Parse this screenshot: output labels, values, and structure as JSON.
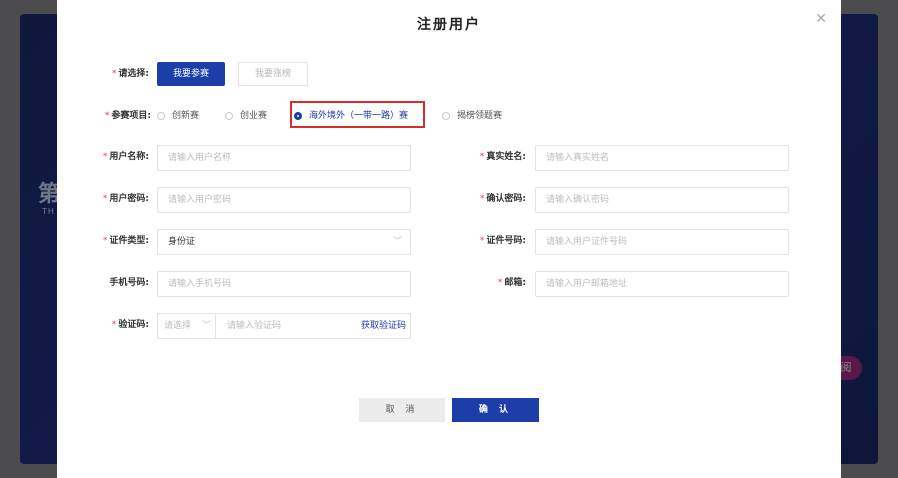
{
  "background": {
    "left_heading": "第",
    "left_sub": "TH",
    "right_button": "阅"
  },
  "modal": {
    "title": "注册用户",
    "close_icon": "close-icon"
  },
  "choose": {
    "label": "请选择:",
    "options": [
      "我要参赛",
      "我要涨榜"
    ],
    "selected": "我要参赛"
  },
  "project": {
    "label": "参赛项目:",
    "options": [
      "创新赛",
      "创业赛",
      "海外境外（一带一路）赛",
      "揭榜领题赛"
    ],
    "selected": "海外境外（一带一路）赛"
  },
  "fields": {
    "username": {
      "label": "用户名称:",
      "placeholder": "请输入用户名称",
      "required": true
    },
    "realname": {
      "label": "真实姓名:",
      "placeholder": "请输入真实姓名",
      "required": true
    },
    "password": {
      "label": "用户密码:",
      "placeholder": "请输入用户密码",
      "required": true
    },
    "confirm_password": {
      "label": "确认密码:",
      "placeholder": "请输入确认密码",
      "required": true
    },
    "id_type": {
      "label": "证件类型:",
      "value": "身份证",
      "required": true
    },
    "id_number": {
      "label": "证件号码:",
      "placeholder": "请输入用户证件号码",
      "required": true
    },
    "phone": {
      "label": "手机号码:",
      "placeholder": "请输入手机号码",
      "required": false
    },
    "email": {
      "label": "邮箱:",
      "placeholder": "请输入用户邮箱地址",
      "required": true
    },
    "captcha": {
      "label": "验证码:",
      "select_placeholder": "请选择",
      "placeholder": "请输入验证码",
      "get_code": "获取验证码",
      "required": true
    }
  },
  "actions": {
    "cancel": "取 消",
    "confirm": "确 认"
  },
  "required_mark": "*",
  "colors": {
    "primary": "#1b3ea8",
    "required": "#e0434b",
    "highlight": "#d62d2d"
  }
}
